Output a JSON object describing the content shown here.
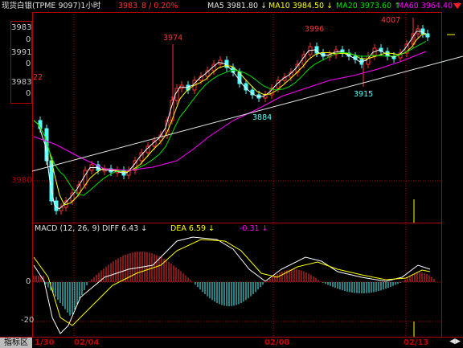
{
  "header": {
    "title": "现货白银(TPME 9097)1小时",
    "price": "3983",
    "change": "8 / 0.20%",
    "ma5": "MA5 3981.80 ↓",
    "ma10": "MA10 3984.50 ↓",
    "ma20": "MA20 3973.60 ↑",
    "ma60": "MA60 3964.40 ↑"
  },
  "price_panel": {
    "axis_labels": [
      "3983",
      "0",
      "3991",
      "0",
      "3983",
      "0",
      "3980",
      "22"
    ],
    "peak_labels": [
      "3974",
      "3996",
      "4007",
      "3884",
      "3915"
    ]
  },
  "macd_panel": {
    "label": "MACD (12, 26, 9)",
    "diff": "DIFF  6.43 ↓",
    "dea": "DEA  6.59 ↓",
    "macd": "-0.31 ↓",
    "axis_labels": [
      "0",
      "-20"
    ]
  },
  "x_axis": [
    "1/30",
    "02/04",
    "02/08",
    "02/13"
  ],
  "footer": {
    "tab": "指标区"
  },
  "colors": {
    "up": "#ff3232",
    "down": "#54ffff",
    "ma5": "#ffffff",
    "ma10": "#ffff00",
    "ma20": "#00e000",
    "ma60": "#ff00ff",
    "frame": "#b40000"
  }
}
